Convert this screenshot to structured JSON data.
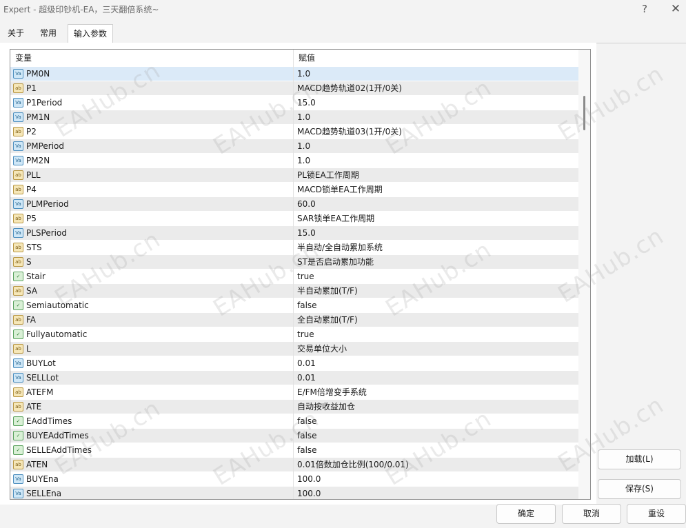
{
  "window": {
    "title": "Expert - 超级印钞机-EA，三天翻倍系统~",
    "help_label": "?",
    "close_label": "✕"
  },
  "tabs": [
    {
      "label": "关于",
      "active": false
    },
    {
      "label": "常用",
      "active": false
    },
    {
      "label": "输入参数",
      "active": true
    }
  ],
  "table": {
    "columns": [
      "变量",
      "赋值"
    ],
    "rows": [
      {
        "type": "num",
        "name": "PM0N",
        "value": "1.0",
        "selected": true
      },
      {
        "type": "str",
        "name": "P1",
        "value": "MACD趋势轨道02(1开/0关)"
      },
      {
        "type": "num",
        "name": "P1Period",
        "value": "15.0"
      },
      {
        "type": "num",
        "name": "PM1N",
        "value": "1.0"
      },
      {
        "type": "str",
        "name": "P2",
        "value": "MACD趋势轨道03(1开/0关)"
      },
      {
        "type": "num",
        "name": "PMPeriod",
        "value": "1.0"
      },
      {
        "type": "num",
        "name": "PM2N",
        "value": "1.0"
      },
      {
        "type": "str",
        "name": "PLL",
        "value": "PL锁EA工作周期"
      },
      {
        "type": "str",
        "name": "P4",
        "value": "MACD锁单EA工作周期"
      },
      {
        "type": "num",
        "name": "PLMPeriod",
        "value": "60.0"
      },
      {
        "type": "str",
        "name": "P5",
        "value": "SAR锁单EA工作周期"
      },
      {
        "type": "num",
        "name": "PLSPeriod",
        "value": "15.0"
      },
      {
        "type": "str",
        "name": "STS",
        "value": "半自动/全自动累加系统"
      },
      {
        "type": "str",
        "name": "S",
        "value": "ST是否启动累加功能"
      },
      {
        "type": "bool",
        "name": "Stair",
        "value": "true"
      },
      {
        "type": "str",
        "name": "SA",
        "value": "半自动累加(T/F)"
      },
      {
        "type": "bool",
        "name": "Semiautomatic",
        "value": "false"
      },
      {
        "type": "str",
        "name": "FA",
        "value": "全自动累加(T/F)"
      },
      {
        "type": "bool",
        "name": "Fullyautomatic",
        "value": "true"
      },
      {
        "type": "str",
        "name": "L",
        "value": "交易单位大小"
      },
      {
        "type": "num",
        "name": "BUYLot",
        "value": "0.01"
      },
      {
        "type": "num",
        "name": "SELLLot",
        "value": "0.01"
      },
      {
        "type": "str",
        "name": "ATEFM",
        "value": "E/FM倍增变手系统"
      },
      {
        "type": "str",
        "name": "ATE",
        "value": "自动按收益加仓"
      },
      {
        "type": "bool",
        "name": "EAddTimes",
        "value": "false"
      },
      {
        "type": "bool",
        "name": "BUYEAddTimes",
        "value": "false"
      },
      {
        "type": "bool",
        "name": "SELLEAddTimes",
        "value": "false"
      },
      {
        "type": "str",
        "name": "ATEN",
        "value": "0.01倍数加仓比例(100/0.01)"
      },
      {
        "type": "num",
        "name": "BUYEna",
        "value": "100.0"
      },
      {
        "type": "num",
        "name": "SELLEna",
        "value": "100.0"
      }
    ]
  },
  "icons": {
    "num": "Va",
    "str": "ab",
    "bool": "✓"
  },
  "buttons": {
    "load": "加载(L)",
    "save": "保存(S)",
    "ok": "确定",
    "cancel": "取消",
    "reset": "重设"
  },
  "watermark": "EAHub.cn"
}
